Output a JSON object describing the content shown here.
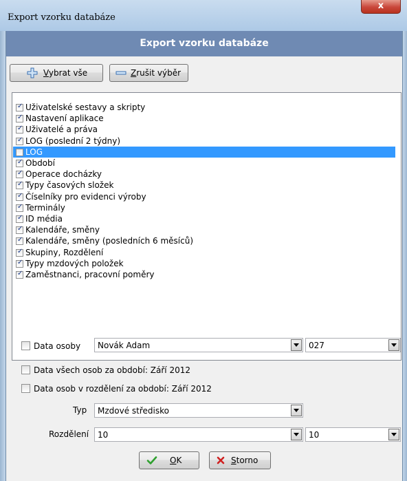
{
  "window": {
    "title": "Export vzorku databáze",
    "close_symbol": "x"
  },
  "header": {
    "title": "Export vzorku databáze"
  },
  "toolbar": {
    "select_all": {
      "mnemonic": "V",
      "rest": "ybrat vše"
    },
    "deselect": {
      "mnemonic": "Z",
      "rest": "rušit výběr"
    }
  },
  "items": [
    {
      "label": "Uživatelské sestavy a skripty",
      "checked": true,
      "selected": false
    },
    {
      "label": "Nastavení aplikace",
      "checked": true,
      "selected": false
    },
    {
      "label": "Uživatelé a práva",
      "checked": true,
      "selected": false
    },
    {
      "label": "LOG (poslední 2 týdny)",
      "checked": true,
      "selected": false
    },
    {
      "label": "LOG",
      "checked": false,
      "selected": true
    },
    {
      "label": "Období",
      "checked": true,
      "selected": false
    },
    {
      "label": "Operace docházky",
      "checked": true,
      "selected": false
    },
    {
      "label": "Typy časových složek",
      "checked": true,
      "selected": false
    },
    {
      "label": "Číselníky pro evidenci výroby",
      "checked": true,
      "selected": false
    },
    {
      "label": "Terminály",
      "checked": true,
      "selected": false
    },
    {
      "label": "ID média",
      "checked": true,
      "selected": false
    },
    {
      "label": "Kalendáře, směny",
      "checked": true,
      "selected": false
    },
    {
      "label": "Kalendáře, směny (posledních 6 měsíců)",
      "checked": true,
      "selected": false
    },
    {
      "label": "Skupiny, Rozdělení",
      "checked": true,
      "selected": false
    },
    {
      "label": "Typy mzdových položek",
      "checked": true,
      "selected": false
    },
    {
      "label": "Zaměstnanci, pracovní poměry",
      "checked": true,
      "selected": false
    }
  ],
  "options": {
    "person_data": {
      "label": "Data osoby",
      "checked": false,
      "name_value": "Novák  Adam",
      "number_value": "027"
    },
    "all_persons": {
      "label": "Data všech osob za období: Září 2012",
      "checked": false
    },
    "division_persons": {
      "label": "Data osob v rozdělení  za období: Září 2012",
      "checked": false
    },
    "type": {
      "label": "Typ",
      "value": "Mzdové středisko"
    },
    "division": {
      "label": "Rozdělení",
      "value_a": "10",
      "value_b": "10"
    }
  },
  "footer": {
    "ok": {
      "mnemonic": "O",
      "rest": "K"
    },
    "cancel": {
      "mnemonic": "S",
      "rest": "torno"
    }
  },
  "colors": {
    "header_bg": "#6f8ab3",
    "selection": "#3399ff",
    "ok_icon": "#2ea02e",
    "cancel_icon": "#d02020"
  }
}
